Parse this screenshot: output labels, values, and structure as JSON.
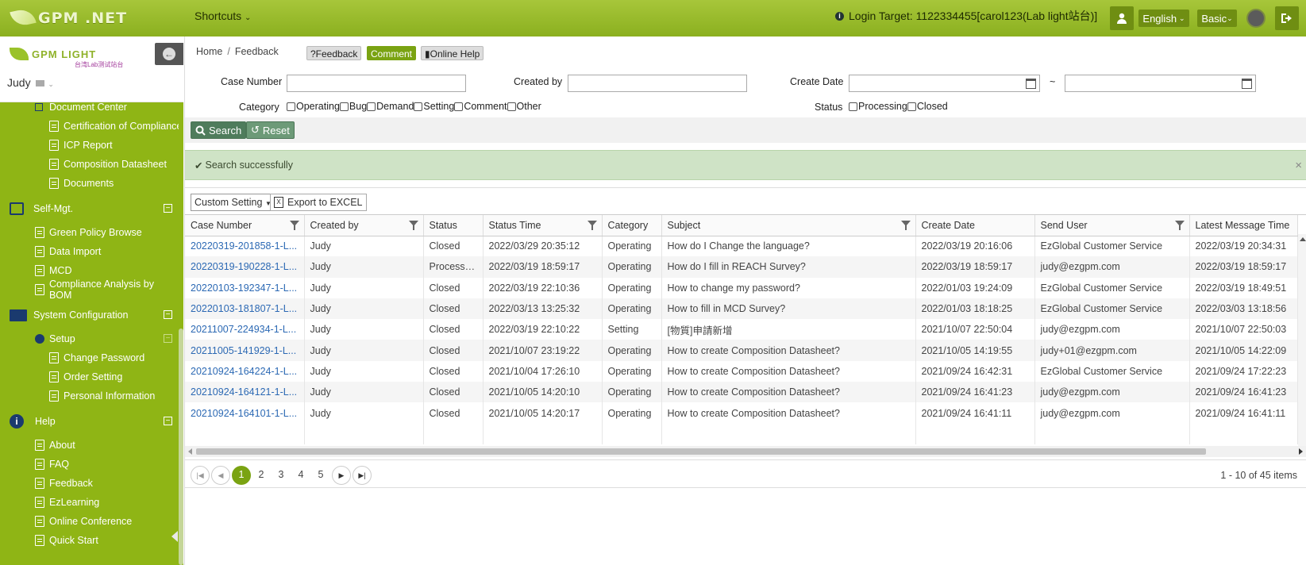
{
  "topbar": {
    "brand": "GPM .NET",
    "shortcuts": "Shortcuts",
    "login_target": "Login Target: 1122334455[carol123(Lab light站台)]",
    "language": "English",
    "mode": "Basic"
  },
  "sidebar": {
    "brand": "GPM LIGHT",
    "brand_sub": "台湾Lab测试站台",
    "user": "Judy",
    "items": [
      {
        "label": "Document Center",
        "level": 1
      },
      {
        "label": "Certification of Compliance",
        "level": 2
      },
      {
        "label": "ICP Report",
        "level": 2
      },
      {
        "label": "Composition Datasheet",
        "level": 2
      },
      {
        "label": "Documents",
        "level": 2
      },
      {
        "label": "Self-Mgt.",
        "level": 0
      },
      {
        "label": "Green Policy Browse",
        "level": 1
      },
      {
        "label": "Data Import",
        "level": 1
      },
      {
        "label": "MCD",
        "level": 1
      },
      {
        "label": "Compliance Analysis by BOM",
        "level": 1
      },
      {
        "label": "System Configuration",
        "level": 0
      },
      {
        "label": "Setup",
        "level": 1
      },
      {
        "label": "Change Password",
        "level": 2
      },
      {
        "label": "Order Setting",
        "level": 2
      },
      {
        "label": "Personal Information",
        "level": 2
      },
      {
        "label": "Help",
        "level": 0
      },
      {
        "label": "About",
        "level": 1
      },
      {
        "label": "FAQ",
        "level": 1
      },
      {
        "label": "Feedback",
        "level": 1
      },
      {
        "label": "EzLearning",
        "level": 1
      },
      {
        "label": "Online Conference",
        "level": 1
      },
      {
        "label": "Quick Start",
        "level": 1
      }
    ]
  },
  "breadcrumb": {
    "home": "Home",
    "sep": "/",
    "current": "Feedback"
  },
  "chips": {
    "feedback": "?Feedback",
    "comment": "Comment",
    "help": "Online Help"
  },
  "filters": {
    "case_number": "Case Number",
    "created_by": "Created by",
    "create_date": "Create Date",
    "date_sep": "~",
    "category": "Category",
    "categories": [
      "Operating",
      "Bug",
      "Demand",
      "Setting",
      "Comment",
      "Other"
    ],
    "status": "Status",
    "statuses": [
      "Processing",
      "Closed"
    ]
  },
  "buttons": {
    "search": "Search",
    "reset": "Reset",
    "custom_setting": "Custom Setting",
    "export": "Export to EXCEL"
  },
  "alert": {
    "message": "Search successfully",
    "close": "×"
  },
  "table": {
    "columns": [
      "Case Number",
      "Created by",
      "Status",
      "Status Time",
      "Category",
      "Subject",
      "Create Date",
      "Send User",
      "Latest Message Time"
    ],
    "rows": [
      [
        "20220319-201858-1-L...",
        "Judy",
        "Closed",
        "2022/03/29 20:35:12",
        "Operating",
        "How do I Change the language?",
        "2022/03/19 20:16:06",
        "EzGlobal Customer Service",
        "2022/03/19 20:34:31"
      ],
      [
        "20220319-190228-1-L...",
        "Judy",
        "Processing",
        "2022/03/19 18:59:17",
        "Operating",
        "How do I fill in REACH Survey?",
        "2022/03/19 18:59:17",
        "judy@ezgpm.com",
        "2022/03/19 18:59:17"
      ],
      [
        "20220103-192347-1-L...",
        "Judy",
        "Closed",
        "2022/03/19 22:10:36",
        "Operating",
        "How to change my password?",
        "2022/01/03 19:24:09",
        "EzGlobal Customer Service",
        "2022/03/19 18:49:51"
      ],
      [
        "20220103-181807-1-L...",
        "Judy",
        "Closed",
        "2022/03/13 13:25:32",
        "Operating",
        "How to fill in MCD Survey?",
        "2022/01/03 18:18:25",
        "EzGlobal Customer Service",
        "2022/03/03 13:18:56"
      ],
      [
        "20211007-224934-1-L...",
        "Judy",
        "Closed",
        "2022/03/19 22:10:22",
        "Setting",
        "[物質]申請新增",
        "2021/10/07 22:50:04",
        "judy@ezgpm.com",
        "2021/10/07 22:50:03"
      ],
      [
        "20211005-141929-1-L...",
        "Judy",
        "Closed",
        "2021/10/07 23:19:22",
        "Operating",
        "How to create Composition Datasheet?",
        "2021/10/05 14:19:55",
        "judy+01@ezgpm.com",
        "2021/10/05 14:22:09"
      ],
      [
        "20210924-164224-1-L...",
        "Judy",
        "Closed",
        "2021/10/04 17:26:10",
        "Operating",
        "How to create Composition Datasheet?",
        "2021/09/24 16:42:31",
        "EzGlobal Customer Service",
        "2021/09/24 17:22:23"
      ],
      [
        "20210924-164121-1-L...",
        "Judy",
        "Closed",
        "2021/10/05 14:20:10",
        "Operating",
        "How to create Composition Datasheet?",
        "2021/09/24 16:41:23",
        "judy@ezgpm.com",
        "2021/09/24 16:41:23"
      ],
      [
        "20210924-164101-1-L...",
        "Judy",
        "Closed",
        "2021/10/05 14:20:17",
        "Operating",
        "How to create Composition Datasheet?",
        "2021/09/24 16:41:11",
        "judy@ezgpm.com",
        "2021/09/24 16:41:11"
      ]
    ]
  },
  "pager": {
    "pages": [
      "1",
      "2",
      "3",
      "4",
      "5"
    ],
    "info": "1 - 10 of 45 items"
  },
  "colors": {
    "topbar": "#8bb01f",
    "sidebar": "#8fb515",
    "accent": "#7aa312",
    "link": "#2c69b4",
    "success_bg": "#cfe3c6"
  }
}
